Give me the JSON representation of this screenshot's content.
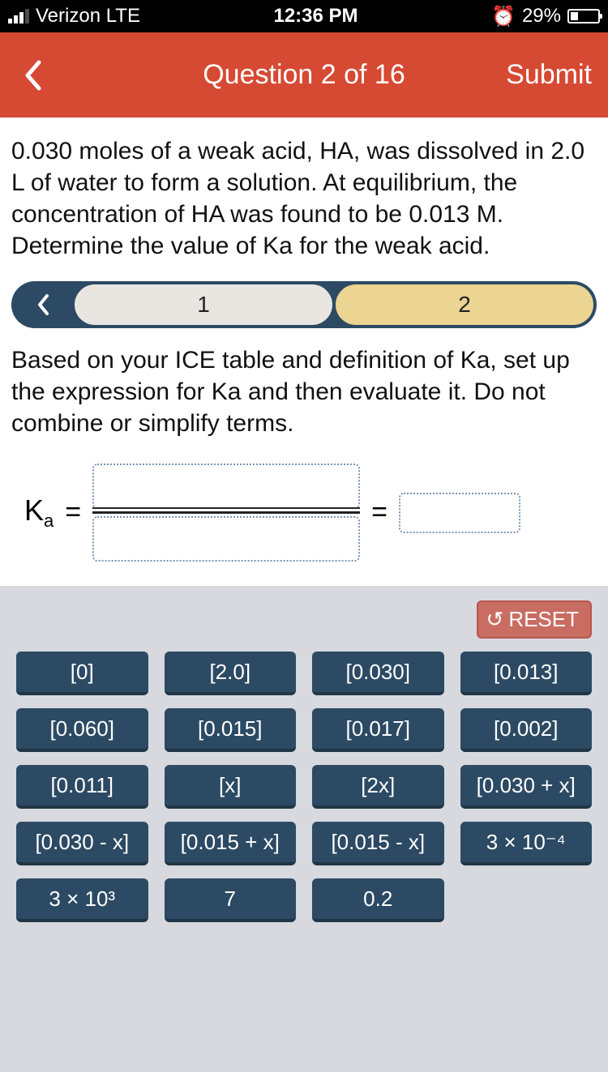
{
  "status": {
    "carrier": "Verizon  LTE",
    "time": "12:36 PM",
    "battery_pct": "29%",
    "battery_fill_pct": 29
  },
  "header": {
    "title": "Question 2 of 16",
    "submit": "Submit"
  },
  "question": "0.030 moles of a weak acid, HA, was dissolved in 2.0 L of water to form a solution. At equilibrium, the concentration of HA was found to be 0.013 M. Determine the value of Ka for the weak acid.",
  "steps": {
    "one": "1",
    "two": "2"
  },
  "instruction": "Based on your ICE table and definition of Ka, set up the expression for Ka and then evaluate it. Do not combine or simplify terms.",
  "equation": {
    "ka": "K",
    "ka_sub": "a",
    "eq": "="
  },
  "reset": "RESET",
  "tiles": [
    "[0]",
    "[2.0]",
    "[0.030]",
    "[0.013]",
    "[0.060]",
    "[0.015]",
    "[0.017]",
    "[0.002]",
    "[0.011]",
    "[x]",
    "[2x]",
    "[0.030 + x]",
    "[0.030 - x]",
    "[0.015 + x]",
    "[0.015 - x]",
    "3 × 10⁻⁴",
    "3 × 10³",
    "7",
    "0.2"
  ]
}
